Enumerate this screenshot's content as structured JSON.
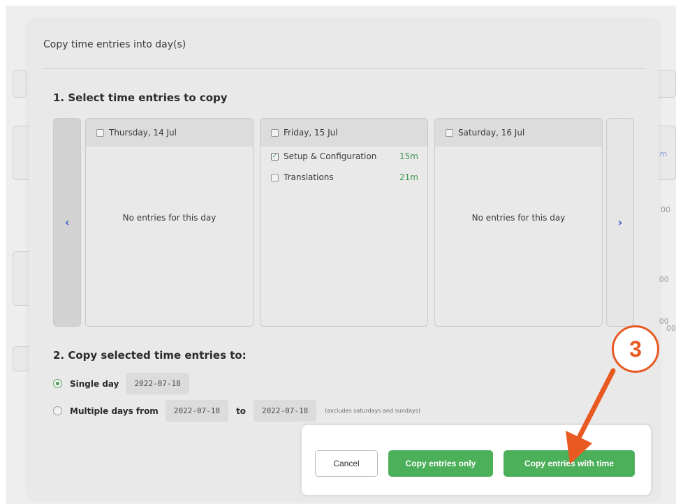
{
  "background": {
    "fragments": [
      "d m",
      "00",
      ":00",
      ":00",
      "00"
    ]
  },
  "modal": {
    "title": "Copy time entries into day(s)",
    "section1_title": "1. Select time entries to copy",
    "days": [
      {
        "label": "Thursday, 14 Jul",
        "empty_message": "No entries for this day"
      },
      {
        "label": "Friday, 15 Jul",
        "entries": [
          {
            "name": "Setup & Configuration",
            "duration": "15m",
            "checked": true
          },
          {
            "name": "Translations",
            "duration": "21m",
            "checked": false
          }
        ]
      },
      {
        "label": "Saturday, 16 Jul",
        "empty_message": "No entries for this day"
      }
    ],
    "nav": {
      "prev_glyph": "‹",
      "next_glyph": "›"
    },
    "section2_title": "2. Copy selected time entries to:",
    "single_day": {
      "label": "Single day",
      "date": "2022-07-18",
      "selected": true
    },
    "multiple_days": {
      "label": "Multiple days from",
      "from": "2022-07-18",
      "to_label": "to",
      "to": "2022-07-18",
      "note": "(excludes saturdays and sundays)",
      "selected": false
    },
    "buttons": {
      "cancel": "Cancel",
      "copy_only": "Copy entries only",
      "copy_with_time": "Copy entries with time"
    }
  },
  "annotation": {
    "step": "3",
    "color": "#e85a22"
  },
  "colors": {
    "accent_green": "#4caf5a",
    "nav_blue": "#3a5fc8"
  }
}
